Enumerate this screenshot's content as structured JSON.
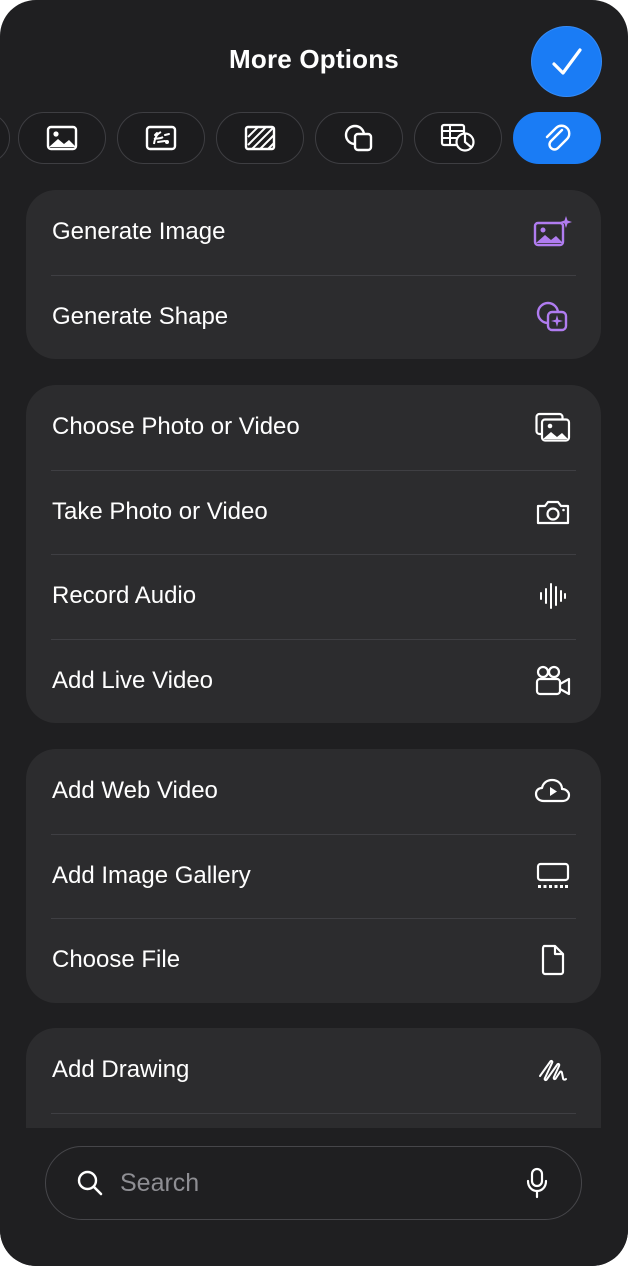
{
  "header": {
    "title": "More Options"
  },
  "tabs": [
    {
      "name": "tab-previous"
    },
    {
      "name": "tab-image"
    },
    {
      "name": "tab-media"
    },
    {
      "name": "tab-pattern"
    },
    {
      "name": "tab-shapes"
    },
    {
      "name": "tab-table-chart"
    },
    {
      "name": "tab-attachment",
      "active": true
    }
  ],
  "groups": [
    [
      {
        "label": "Generate Image",
        "icon": "generate-image-icon"
      },
      {
        "label": "Generate Shape",
        "icon": "generate-shape-icon"
      }
    ],
    [
      {
        "label": "Choose Photo or Video",
        "icon": "photo-library-icon"
      },
      {
        "label": "Take Photo or Video",
        "icon": "camera-icon"
      },
      {
        "label": "Record Audio",
        "icon": "waveform-icon"
      },
      {
        "label": "Add Live Video",
        "icon": "video-camera-icon"
      }
    ],
    [
      {
        "label": "Add Web Video",
        "icon": "cloud-play-icon"
      },
      {
        "label": "Add Image Gallery",
        "icon": "gallery-icon"
      },
      {
        "label": "Choose File",
        "icon": "document-icon"
      }
    ],
    [
      {
        "label": "Add Drawing",
        "icon": "scribble-icon"
      }
    ]
  ],
  "search": {
    "placeholder": "Search"
  },
  "colors": {
    "accent": "#1a7cf5",
    "ai_purple": "#b07cf0",
    "background": "#1f1f21",
    "card": "#2c2c2e"
  }
}
